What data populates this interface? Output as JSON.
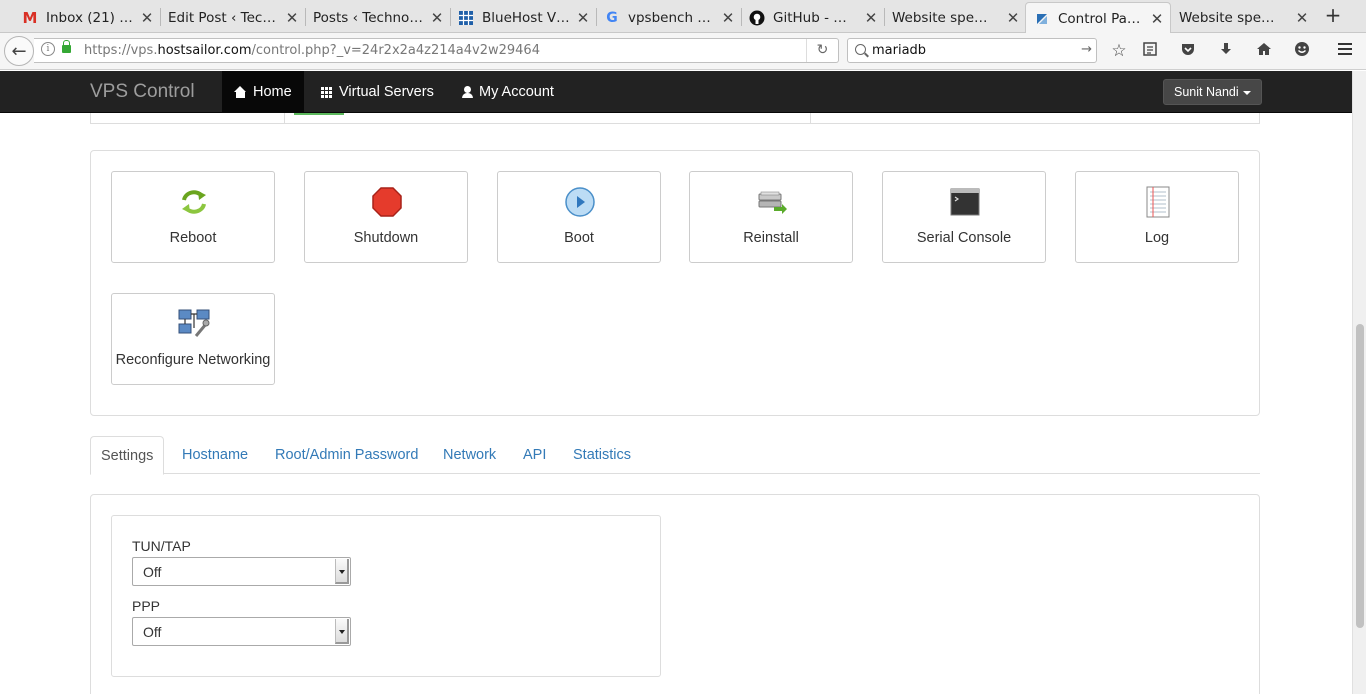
{
  "browser": {
    "tabs": [
      {
        "title": "Inbox (21) …",
        "favicon": "gmail-icon"
      },
      {
        "title": "Edit Post ‹ Tec…",
        "favicon": "blank-icon"
      },
      {
        "title": "Posts ‹ Techno…",
        "favicon": "blank-icon"
      },
      {
        "title": "BlueHost V…",
        "favicon": "globe-icon"
      },
      {
        "title": "vpsbench -…",
        "favicon": "google-icon"
      },
      {
        "title": "GitHub - m…",
        "favicon": "github-icon"
      },
      {
        "title": "Website spe…",
        "favicon": "blank-icon"
      },
      {
        "title": "Control Panel",
        "favicon": "hostsailor-icon",
        "active": true
      },
      {
        "title": "Website spe…",
        "favicon": "blank-icon"
      }
    ],
    "url_prefix": "https://vps.",
    "url_domain": "hostsailor.com",
    "url_suffix": "/control.php?_v=24r2x2a4z214a4v2w29464",
    "search_value": "mariadb"
  },
  "topnav": {
    "brand": "VPS Control",
    "items": [
      {
        "label": "Home",
        "icon": "home-icon"
      },
      {
        "label": "Virtual Servers",
        "icon": "grid-icon"
      },
      {
        "label": "My Account",
        "icon": "user-icon"
      }
    ],
    "user": "Sunit Nandi"
  },
  "actions": [
    {
      "label": "Reboot",
      "icon": "reboot-icon"
    },
    {
      "label": "Shutdown",
      "icon": "shutdown-icon"
    },
    {
      "label": "Boot",
      "icon": "boot-icon"
    },
    {
      "label": "Reinstall",
      "icon": "reinstall-icon"
    },
    {
      "label": "Serial Console",
      "icon": "console-icon"
    },
    {
      "label": "Log",
      "icon": "log-icon"
    },
    {
      "label": "Reconfigure Networking",
      "icon": "networking-icon"
    }
  ],
  "page_tabs": [
    {
      "label": "Settings",
      "active": true
    },
    {
      "label": "Hostname"
    },
    {
      "label": "Root/Admin Password"
    },
    {
      "label": "Network"
    },
    {
      "label": "API"
    },
    {
      "label": "Statistics"
    }
  ],
  "settings": {
    "tuntap_label": "TUN/TAP",
    "tuntap_value": "Off",
    "ppp_label": "PPP",
    "ppp_value": "Off"
  },
  "colors": {
    "navbar": "#222222",
    "link": "#337ab7",
    "accent_green": "#5cb85c"
  }
}
